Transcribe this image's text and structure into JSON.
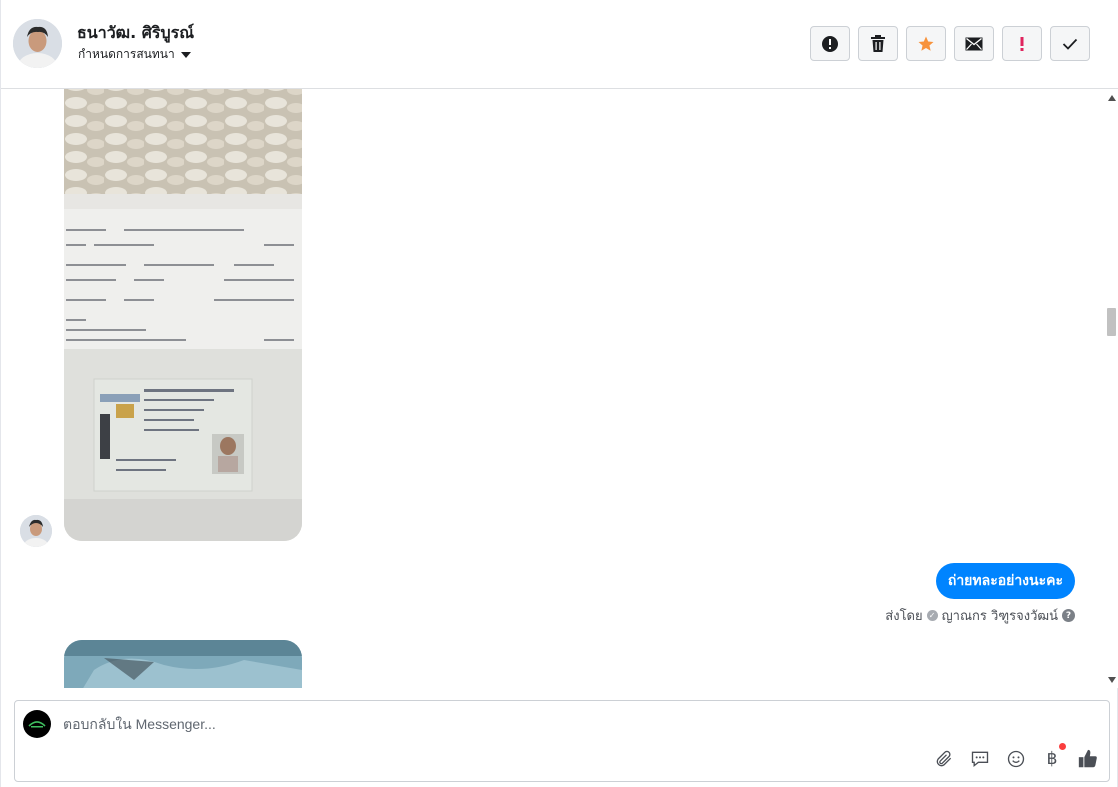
{
  "header": {
    "contact_name": "ธนาวัฒ. ศิริบูรณ์",
    "assign_label": "กำหนดการสนทนา",
    "actions": [
      {
        "name": "report-spam-button",
        "icon": "exclamation-circle-icon"
      },
      {
        "name": "delete-button",
        "icon": "trash-icon"
      },
      {
        "name": "star-button",
        "icon": "star-icon",
        "color": "#f7923b"
      },
      {
        "name": "mark-unread-button",
        "icon": "envelope-icon"
      },
      {
        "name": "follow-up-button",
        "icon": "exclamation-icon",
        "color": "#e0245e"
      },
      {
        "name": "mark-done-button",
        "icon": "check-icon"
      }
    ]
  },
  "conversation": {
    "outgoing_message": "ถ่ายทละอย่างนะคะ",
    "sent_by_prefix": "ส่งโดย",
    "sent_by_name": "ญาณกร วิฑูรจงวัฒน์",
    "bubble_color": "#0084ff"
  },
  "composer": {
    "placeholder": "ตอบกลับใน Messenger...",
    "tools": [
      "paperclip-icon",
      "saved-reply-icon",
      "emoji-icon",
      "baht-payment-icon",
      "like-icon"
    ],
    "baht_symbol": "฿"
  }
}
